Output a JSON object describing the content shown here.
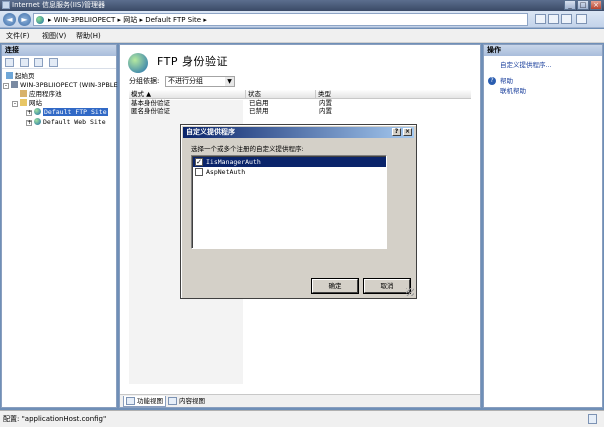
{
  "window": {
    "title": "Internet 信息服务(IIS)管理器",
    "controls": {
      "minimize": "_",
      "maximize": "□",
      "close": "×"
    }
  },
  "address": {
    "back": "◄",
    "forward": "►",
    "crumbs": "▸ WIN-3PBLIIOPECT ▸ 网站 ▸ Default FTP Site ▸"
  },
  "menu": [
    "文件(F)",
    "视图(V)",
    "帮助(H)"
  ],
  "connections": {
    "header": "连接",
    "tree": [
      {
        "label": "起始页",
        "icon": "start-page-icon"
      },
      {
        "label": "WIN-3PBLIIOPECT (WIN-3PBLE",
        "icon": "server-icon",
        "expander": "-"
      },
      {
        "label": "应用程序池",
        "icon": "app-pool-icon"
      },
      {
        "label": "网站",
        "icon": "sites-folder-icon",
        "expander": "-"
      },
      {
        "label": "Default FTP Site",
        "icon": "ftp-site-globe-icon",
        "expander": "+",
        "selected": true
      },
      {
        "label": "Default Web Site",
        "icon": "web-site-globe-icon",
        "expander": "+"
      }
    ]
  },
  "main": {
    "title": "FTP 身份验证",
    "group_label": "分组依据:",
    "group_value": "不进行分组",
    "columns": [
      "模式 ▲",
      "状态",
      "类型"
    ],
    "rows": [
      [
        "基本身份验证",
        "已启用",
        "内置"
      ],
      [
        "匿名身份验证",
        "已禁用",
        "内置"
      ]
    ],
    "tabs": [
      "功能视图",
      "内容视图"
    ]
  },
  "actions": {
    "header": "操作",
    "items": [
      "自定义提供程序...",
      "帮助",
      "联机帮助"
    ]
  },
  "status": "配置: \"applicationHost.config\"",
  "dialog": {
    "title": "自定义提供程序",
    "help_btn": "?",
    "close_btn": "×",
    "prompt": "选择一个或多个注册的自定义提供程序:",
    "providers": [
      {
        "label": "IisManagerAuth",
        "checked": true,
        "selected": true
      },
      {
        "label": "AspNetAuth",
        "checked": false,
        "selected": false
      }
    ],
    "ok": "确定",
    "cancel": "取消"
  },
  "colors": {
    "selection": "#0a246a",
    "tree_selection": "#3169c6",
    "link": "#1a3f9c"
  }
}
